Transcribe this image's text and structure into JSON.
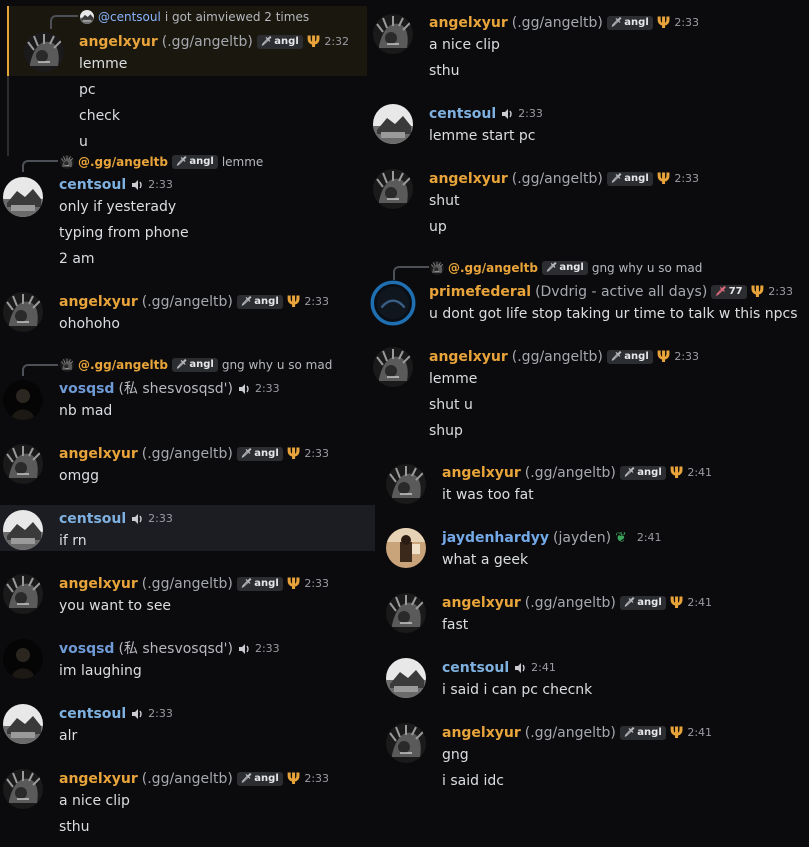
{
  "colors": {
    "angelxyur": "#e8a43a",
    "centsoul": "#7fb1e0",
    "vosqsd": "#6f9ad6",
    "primefederal": "#e8a43a",
    "jaydenhardyy": "#74a9e8",
    "reply_name": "#e8a43a",
    "reply_mention": "#8ab4ff"
  },
  "icons": {
    "volume": "speaker-icon",
    "trident": "trident-icon",
    "badge": "sword-icon",
    "heart": "green-heart-icon"
  },
  "left": {
    "msg1": {
      "reply_to": "@centsoul",
      "reply_text": "i got aimviewed 2 times",
      "user": "angelxyur",
      "tag": "(.gg/angeltb)",
      "badge": "angl",
      "time": "2:32",
      "lines": [
        "lemme",
        "pc",
        "check",
        "u"
      ]
    },
    "msg2": {
      "reply_to": "@.gg/angeltb",
      "reply_badge": "angl",
      "reply_text": "lemme",
      "user": "centsoul",
      "time": "2:33",
      "lines": [
        "only if yesterady",
        "typing from phone",
        "2 am"
      ]
    },
    "msg3": {
      "user": "angelxyur",
      "tag": "(.gg/angeltb)",
      "badge": "angl",
      "time": "2:33",
      "lines": [
        "ohohoho"
      ]
    },
    "msg4": {
      "reply_to": "@.gg/angeltb",
      "reply_badge": "angl",
      "reply_text": "gng why u so mad",
      "user": "vosqsd",
      "tag": "(私 shesvosqsd')",
      "time": "2:33",
      "lines": [
        "nb mad"
      ]
    },
    "msg5": {
      "user": "angelxyur",
      "tag": "(.gg/angeltb)",
      "badge": "angl",
      "time": "2:33",
      "lines": [
        "omgg"
      ]
    },
    "msg6": {
      "user": "centsoul",
      "time": "2:33",
      "lines": [
        "if rn"
      ]
    },
    "msg7": {
      "user": "angelxyur",
      "tag": "(.gg/angeltb)",
      "badge": "angl",
      "time": "2:33",
      "lines": [
        "you want to see"
      ]
    },
    "msg8": {
      "user": "vosqsd",
      "tag": "(私 shesvosqsd')",
      "time": "2:33",
      "lines": [
        "im laughing"
      ]
    },
    "msg9": {
      "user": "centsoul",
      "time": "2:33",
      "lines": [
        "alr"
      ]
    },
    "msg10": {
      "user": "angelxyur",
      "tag": "(.gg/angeltb)",
      "badge": "angl",
      "time": "2:33",
      "lines": [
        "a nice clip",
        "sthu"
      ]
    }
  },
  "right": {
    "msg1": {
      "user": "angelxyur",
      "tag": "(.gg/angeltb)",
      "badge": "angl",
      "time": "2:33",
      "lines": [
        "a nice clip",
        "sthu"
      ]
    },
    "msg2": {
      "user": "centsoul",
      "time": "2:33",
      "lines": [
        "lemme start pc"
      ]
    },
    "msg3": {
      "user": "angelxyur",
      "tag": "(.gg/angeltb)",
      "badge": "angl",
      "time": "2:33",
      "lines": [
        "shut",
        "up"
      ]
    },
    "msg4": {
      "reply_to": "@.gg/angeltb",
      "reply_badge": "angl",
      "reply_text": "gng why u so mad",
      "user": "primefederal",
      "tag": "(Dvdrig - active all days)",
      "badge": "77",
      "time": "2:33",
      "lines": [
        "u dont got life stop taking ur time to talk w this npcs"
      ]
    },
    "msg5": {
      "user": "angelxyur",
      "tag": "(.gg/angeltb)",
      "badge": "angl",
      "time": "2:33",
      "lines": [
        "lemme",
        "shut u",
        "shup"
      ]
    },
    "msg6": {
      "user": "angelxyur",
      "tag": "(.gg/angeltb)",
      "badge": "angl",
      "time": "2:41",
      "lines": [
        "it was too fat"
      ]
    },
    "msg7": {
      "user": "jaydenhardyy",
      "tag": "(jayden)",
      "time": "2:41",
      "lines": [
        "what a geek"
      ]
    },
    "msg8": {
      "user": "angelxyur",
      "tag": "(.gg/angeltb)",
      "badge": "angl",
      "time": "2:41",
      "lines": [
        "fast"
      ]
    },
    "msg9": {
      "user": "centsoul",
      "time": "2:41",
      "lines": [
        "i said i can pc checnk"
      ]
    },
    "msg10": {
      "user": "angelxyur",
      "tag": "(.gg/angeltb)",
      "badge": "angl",
      "time": "2:41",
      "lines": [
        "gng",
        "i said idc"
      ]
    }
  }
}
